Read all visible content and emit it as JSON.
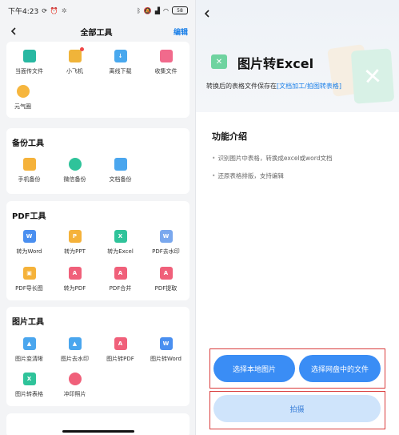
{
  "status": {
    "time": "下午4:23",
    "battery": "58"
  },
  "nav": {
    "back_icon": "chevron-left-icon",
    "title": "全部工具",
    "edit_label": "编辑"
  },
  "top_tools": [
    {
      "label": "当面传文件",
      "icon": "transfer-icon",
      "color": "#28b8a2"
    },
    {
      "label": "小飞机",
      "icon": "plane-icon",
      "color": "#f0b43a",
      "badge": true
    },
    {
      "label": "离线下载",
      "icon": "download-icon",
      "color": "#49a8ee"
    },
    {
      "label": "收集文件",
      "icon": "folder-icon",
      "color": "#f16a8c"
    },
    {
      "label": "元气圈",
      "icon": "circle-icon",
      "color": "#f6b63e"
    }
  ],
  "sections": {
    "backup": {
      "title": "备份工具",
      "items": [
        {
          "label": "手机备份",
          "icon": "phone-backup-icon",
          "color": "#f5b23a"
        },
        {
          "label": "微信备份",
          "icon": "wechat-backup-icon",
          "color": "#2fc39a"
        },
        {
          "label": "文档备份",
          "icon": "doc-backup-icon",
          "color": "#4aa6ee"
        }
      ]
    },
    "pdf": {
      "title": "PDF工具",
      "items": [
        {
          "label": "转为Word",
          "icon": "word-icon",
          "color": "#4a8ff0",
          "glyph": "W"
        },
        {
          "label": "转为PPT",
          "icon": "ppt-icon",
          "color": "#f5b23a",
          "glyph": "P"
        },
        {
          "label": "转为Excel",
          "icon": "excel-icon",
          "color": "#2fc39a",
          "glyph": "X"
        },
        {
          "label": "PDF去水印",
          "icon": "watermark-icon",
          "color": "#7aa8ee",
          "glyph": "W"
        },
        {
          "label": "PDF导长图",
          "icon": "long-image-icon",
          "color": "#f5b23a",
          "glyph": "▣"
        },
        {
          "label": "转为PDF",
          "icon": "to-pdf-icon",
          "color": "#f0607a",
          "glyph": "A"
        },
        {
          "label": "PDF合并",
          "icon": "merge-icon",
          "color": "#f0607a",
          "glyph": "A"
        },
        {
          "label": "PDF提取",
          "icon": "extract-icon",
          "color": "#f0607a",
          "glyph": "A"
        }
      ]
    },
    "image": {
      "title": "图片工具",
      "items": [
        {
          "label": "图片变清晰",
          "icon": "enhance-icon",
          "color": "#4aa6ee",
          "glyph": "▲"
        },
        {
          "label": "图片去水印",
          "icon": "image-watermark-icon",
          "color": "#4aa6ee",
          "glyph": "▲"
        },
        {
          "label": "图片转PDF",
          "icon": "image-to-pdf-icon",
          "color": "#f0607a",
          "glyph": "A"
        },
        {
          "label": "图片转Word",
          "icon": "image-to-word-icon",
          "color": "#4a8ff0",
          "glyph": "W"
        },
        {
          "label": "图片转表格",
          "icon": "image-to-table-icon",
          "color": "#2fc39a",
          "glyph": "X"
        },
        {
          "label": "冲印照片",
          "icon": "print-photo-icon",
          "color": "#f0607a",
          "glyph": "●"
        }
      ]
    }
  },
  "detail": {
    "back_icon": "chevron-left-icon",
    "title": "图片转Excel",
    "subtitle_prefix": "转换后的表格文件保存在",
    "subtitle_link": "[文档加工/拍图转表格]",
    "section_title": "功能介绍",
    "features": [
      "识别图片中表格，转换成excel或word文档",
      "还原表格排版，支持编辑"
    ],
    "btn_local": "选择本地图片",
    "btn_cloud": "选择网盘中的文件",
    "btn_shoot": "拍摄"
  }
}
